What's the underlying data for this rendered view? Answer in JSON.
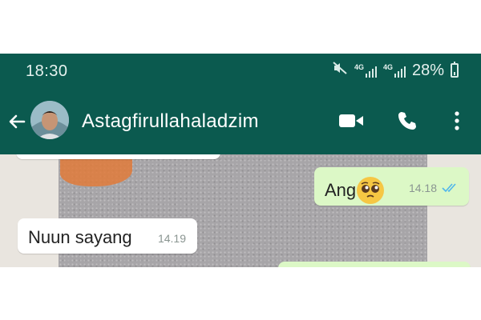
{
  "statusbar": {
    "time": "18:30",
    "net1": "4G",
    "net2": "4G",
    "battery": "28%"
  },
  "appbar": {
    "contact_name": "Astagfirullahaladzim"
  },
  "messages": [
    {
      "direction": "out",
      "text": "Ang",
      "emoji": "pleading-face",
      "time": "14.18",
      "status": "read"
    },
    {
      "direction": "in",
      "text": "Nuun sayang",
      "time": "14.19"
    }
  ],
  "colors": {
    "header": "#0b5a4f",
    "outgoing_bubble": "#dcf8c6",
    "incoming_bubble": "#ffffff",
    "read_ticks": "#4fb6ec"
  }
}
